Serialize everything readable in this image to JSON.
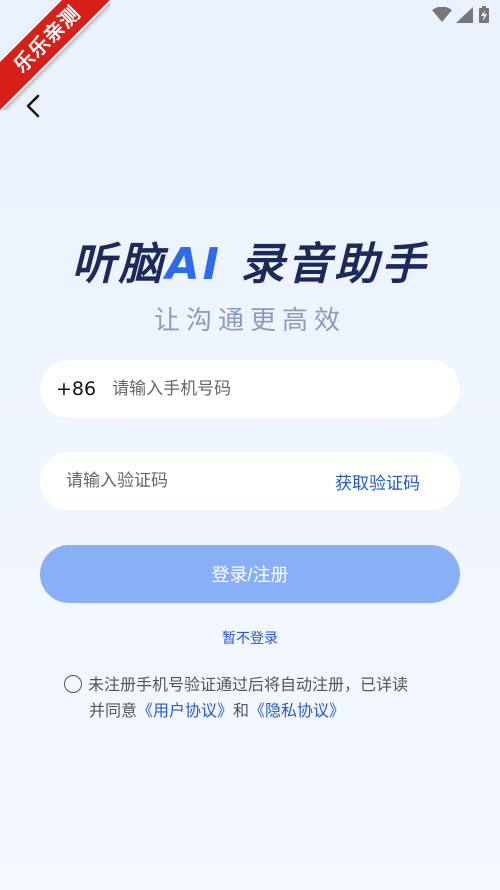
{
  "watermark": {
    "text": "乐乐亲测"
  },
  "status_bar": {
    "icons": [
      "wifi-icon",
      "signal-icon",
      "battery-charging-icon"
    ]
  },
  "header": {
    "back_icon": "chevron-left-icon"
  },
  "brand": {
    "title_part1": "听脑",
    "title_ai": "AI",
    "title_part2": "录音助手",
    "subtitle": "让沟通更高效"
  },
  "phone": {
    "prefix": "+86",
    "placeholder": "请输入手机号码",
    "value": ""
  },
  "code": {
    "placeholder": "请输入验证码",
    "value": "",
    "get_code_label": "获取验证码"
  },
  "login_button": {
    "label": "登录/注册"
  },
  "skip_login": {
    "label": "暂不登录"
  },
  "agreement": {
    "checked": false,
    "text_line1": "未注册手机号验证通过后将自动注册，已详读",
    "text_prefix": "并同意",
    "user_agreement": "《用户协议》",
    "and": "和",
    "privacy_policy": "《隐私协议》"
  },
  "colors": {
    "accent": "#2559c9",
    "title": "#1c2a5a",
    "ai": "#2f6be8",
    "button": "#89b0f6",
    "ribbon": "#d7201a"
  }
}
